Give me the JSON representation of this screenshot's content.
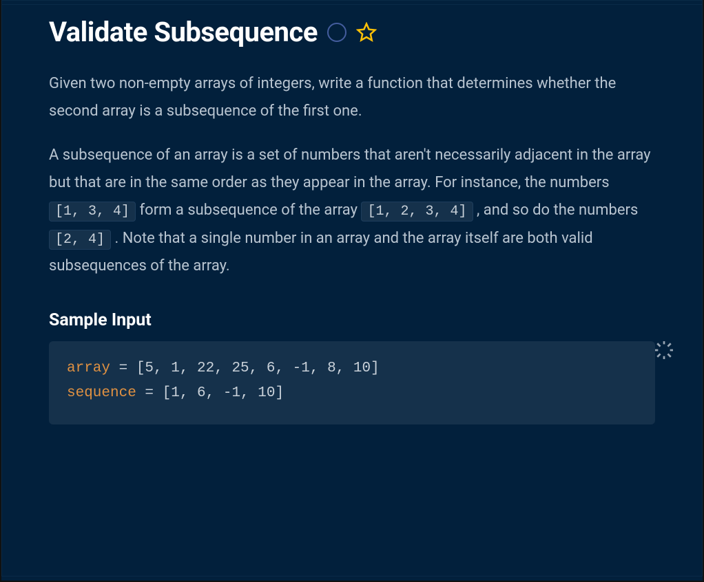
{
  "problem": {
    "title": "Validate Subsequence",
    "paragraph1": "Given two non-empty arrays of integers, write a function that determines whether the second array is a subsequence of the first one.",
    "p2_part1": "A subsequence of an array is a set of numbers that aren't necessarily adjacent in the array but that are in the same order as they appear in the array. For instance, the numbers ",
    "p2_code1": "[1, 3, 4]",
    "p2_part2": " form a subsequence of the array ",
    "p2_code2": "[1, 2, 3, 4]",
    "p2_part3": " , and so do the numbers ",
    "p2_code3": "[2, 4]",
    "p2_part4": " . Note that a single number in an array and the array itself are both valid subsequences of the array."
  },
  "sample_input": {
    "heading": "Sample Input",
    "line1_var": "array",
    "line1_rest": " = [5, 1, 22, 25, 6, -1, 8, 10]",
    "line2_var": "sequence",
    "line2_rest": " = [1, 6, -1, 10]"
  }
}
